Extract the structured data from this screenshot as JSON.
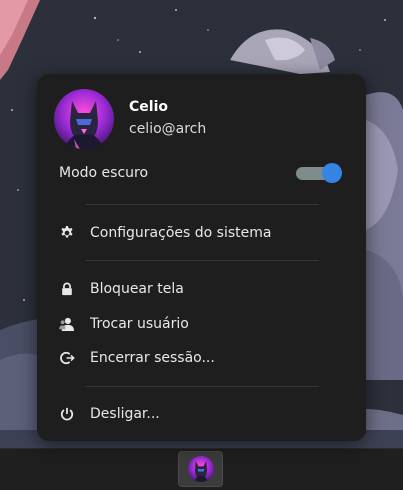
{
  "user": {
    "name": "Celio",
    "handle": "celio@arch"
  },
  "dark_mode": {
    "label": "Modo escuro",
    "enabled": true
  },
  "menu_items": {
    "settings": "Configurações do sistema",
    "lock": "Bloquear tela",
    "switch_user": "Trocar usuário",
    "logout": "Encerrar sessão...",
    "shutdown": "Desligar..."
  },
  "colors": {
    "accent": "#3584e4",
    "menu_bg": "#1e1e1e",
    "panel_bg": "#1f1f1f"
  },
  "icons": [
    "gear-icon",
    "lock-icon",
    "user-switch-icon",
    "logout-icon",
    "power-icon"
  ]
}
